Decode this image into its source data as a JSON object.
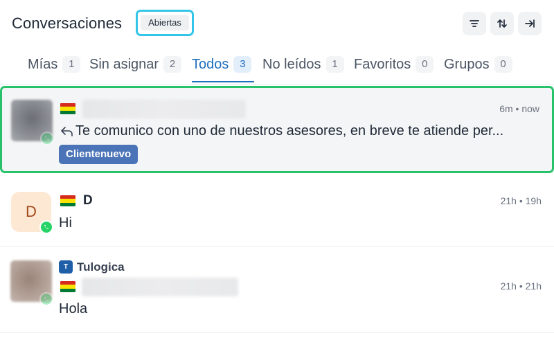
{
  "header": {
    "title": "Conversaciones",
    "status_filter": "Abiertas",
    "buttons": [
      {
        "name": "filter",
        "icon": "filter-icon"
      },
      {
        "name": "sort",
        "icon": "sort-icon"
      },
      {
        "name": "collapse",
        "icon": "collapse-right-icon"
      }
    ]
  },
  "tabs": [
    {
      "label": "Mías",
      "count": "1",
      "active": false
    },
    {
      "label": "Sin asignar",
      "count": "2",
      "active": false
    },
    {
      "label": "Todos",
      "count": "3",
      "active": true
    },
    {
      "label": "No leídos",
      "count": "1",
      "active": false
    },
    {
      "label": "Favoritos",
      "count": "0",
      "active": false
    },
    {
      "label": "Grupos",
      "count": "0",
      "active": false
    }
  ],
  "conversations": [
    {
      "name": "",
      "country_flag": "bolivia",
      "time": "6m • now",
      "message": "Te comunico con uno de nuestros asesores, en breve te atiende per...",
      "reply_icon": "reply-arrow-icon",
      "label": "Clientenuevo",
      "selected": true
    },
    {
      "avatar_letter": "D",
      "name": "D",
      "country_flag": "bolivia",
      "time": "21h • 19h",
      "message": "Hi",
      "channel": "whatsapp"
    },
    {
      "inbox_initial": "T",
      "inbox_name": "Tulogica",
      "name": "",
      "country_flag": "bolivia",
      "time": "21h • 21h",
      "message": "Hola",
      "channel": "whatsapp"
    }
  ],
  "colors": {
    "accent": "#1f6fbf",
    "selected_border": "#27c26a",
    "focus_ring": "#34c6e8",
    "label_bg": "#4b73b8",
    "whatsapp": "#25d366"
  }
}
